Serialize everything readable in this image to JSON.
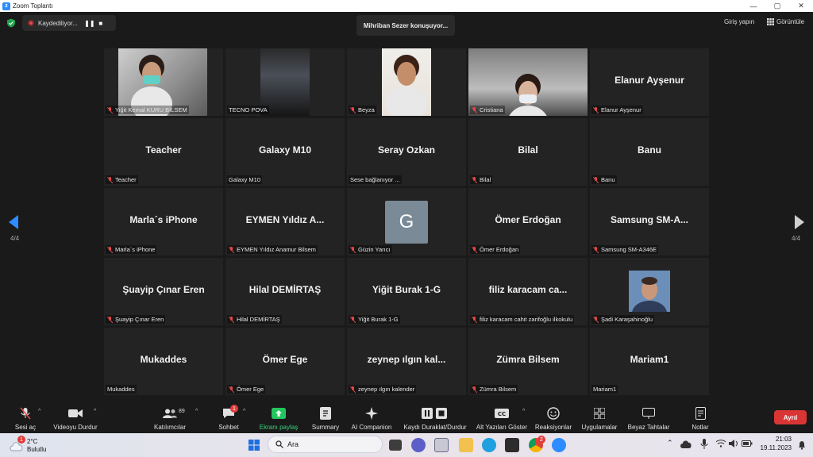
{
  "window": {
    "title": "Zoom Toplantı",
    "minimize": "—",
    "maximize": "▢",
    "close": "✕"
  },
  "topbar": {
    "recording_label": "Kaydediliyor...",
    "speaking": "Mihriban Sezer konuşuyor...",
    "signin": "Giriş yapın",
    "view": "Görüntüle"
  },
  "grid": {
    "tiles": [
      {
        "label": "Yiğit Kemal KURU BİLSEM",
        "big": "",
        "muted": true,
        "video": true
      },
      {
        "label": "TECNO POVA",
        "big": "",
        "muted": false,
        "video": true
      },
      {
        "label": "Beyza",
        "big": "",
        "muted": true,
        "video": true
      },
      {
        "label": "Cristiana",
        "big": "",
        "muted": true,
        "video": true
      },
      {
        "label": "Elanur Ayşenur",
        "big": "Elanur Ayşenur",
        "muted": true
      },
      {
        "label": "Teacher",
        "big": "Teacher",
        "muted": true
      },
      {
        "label": "Galaxy M10",
        "big": "Galaxy M10",
        "muted": false
      },
      {
        "label": "Sese bağlanıyor ...",
        "big": "Seray Ozkan",
        "muted": false
      },
      {
        "label": "Bilal",
        "big": "Bilal",
        "muted": true
      },
      {
        "label": "Banu",
        "big": "Banu",
        "muted": true
      },
      {
        "label": "Marla´s iPhone",
        "big": "Marla´s iPhone",
        "muted": true
      },
      {
        "label": "EYMEN Yıldız Anamur Bilsem",
        "big": "EYMEN Yıldız A...",
        "muted": true
      },
      {
        "label": "Güzin Yarıcı",
        "big": "",
        "avatar": "G",
        "muted": true
      },
      {
        "label": "Ömer Erdoğan",
        "big": "Ömer Erdoğan",
        "muted": true
      },
      {
        "label": "Samsung SM-A346E",
        "big": "Samsung SM-A...",
        "muted": true
      },
      {
        "label": "Şuayip Çınar Eren",
        "big": "Şuayip Çınar Eren",
        "muted": true
      },
      {
        "label": "Hilal DEMİRTAŞ",
        "big": "Hilal DEMİRTAŞ",
        "muted": true
      },
      {
        "label": "Yiğit Burak 1-G",
        "big": "Yiğit Burak 1-G",
        "muted": true
      },
      {
        "label": "filiz karacam cahit zarifoğlu ilkokulu",
        "big": "filiz karacam ca...",
        "muted": true
      },
      {
        "label": "Şadi Karaşahinoğlu",
        "big": "",
        "photo": true,
        "muted": true
      },
      {
        "label": "Mukaddes",
        "big": "Mukaddes",
        "muted": false
      },
      {
        "label": "Ömer Ege",
        "big": "Ömer Ege",
        "muted": true
      },
      {
        "label": "zeynep ılgın kalender",
        "big": "zeynep ılgın kal...",
        "muted": true
      },
      {
        "label": "Zümra Bilsem",
        "big": "Zümra Bilsem",
        "muted": true
      },
      {
        "label": "Mariam1",
        "big": "Mariam1",
        "muted": false
      }
    ],
    "page_left": "4/4",
    "page_right": "4/4"
  },
  "toolbar": {
    "audio": "Sesi aç",
    "video": "Videoyu Durdur",
    "participants": "Katılımcılar",
    "participants_count": "89",
    "chat": "Sohbet",
    "chat_badge": "1",
    "share": "Ekranı paylaş",
    "summary": "Summary",
    "ai": "AI Companion",
    "record": "Kaydı Duraklat/Durdur",
    "captions": "Alt Yazıları Göster",
    "reactions": "Reaksiyonlar",
    "apps": "Uygulamalar",
    "whiteboard": "Beyaz Tahtalar",
    "notes": "Notlar",
    "leave": "Ayrıl"
  },
  "taskbar": {
    "temperature": "2°C",
    "condition": "Bulutlu",
    "weather_badge": "1",
    "search": "Ara",
    "time": "21:03",
    "date": "19.11.2023",
    "chrome_badge": "2"
  },
  "colors": {
    "accent": "#2d8cff",
    "leave": "#d93535",
    "muted": "#e14848",
    "share": "#23c55e"
  }
}
